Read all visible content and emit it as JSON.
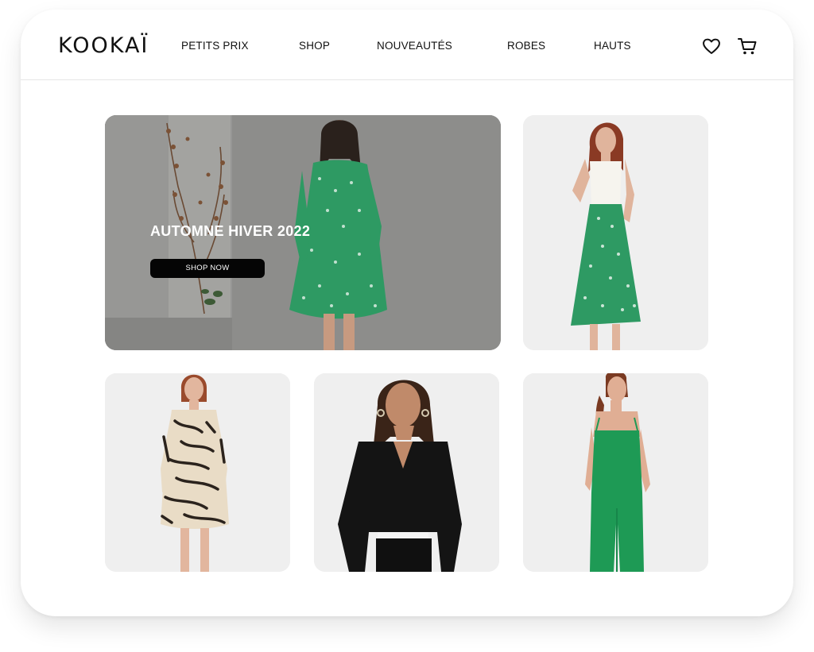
{
  "brand": {
    "logo_text": "KOOKAÏ"
  },
  "nav": {
    "items": [
      {
        "label": "PETITS PRIX"
      },
      {
        "label": "SHOP"
      },
      {
        "label": "NOUVEAUTÉS"
      },
      {
        "label": "ROBES"
      },
      {
        "label": "HAUTS"
      }
    ]
  },
  "header_icons": [
    "heart-icon",
    "cart-icon"
  ],
  "hero": {
    "title": "AUTOMNE HIVER 2022",
    "button_label": "SHOP NOW"
  },
  "colors": {
    "hero_overlay": "#8c8c8a",
    "green_print": "#2e9a63",
    "jumpsuit_green": "#1e9a55",
    "button_bg": "#050505"
  }
}
